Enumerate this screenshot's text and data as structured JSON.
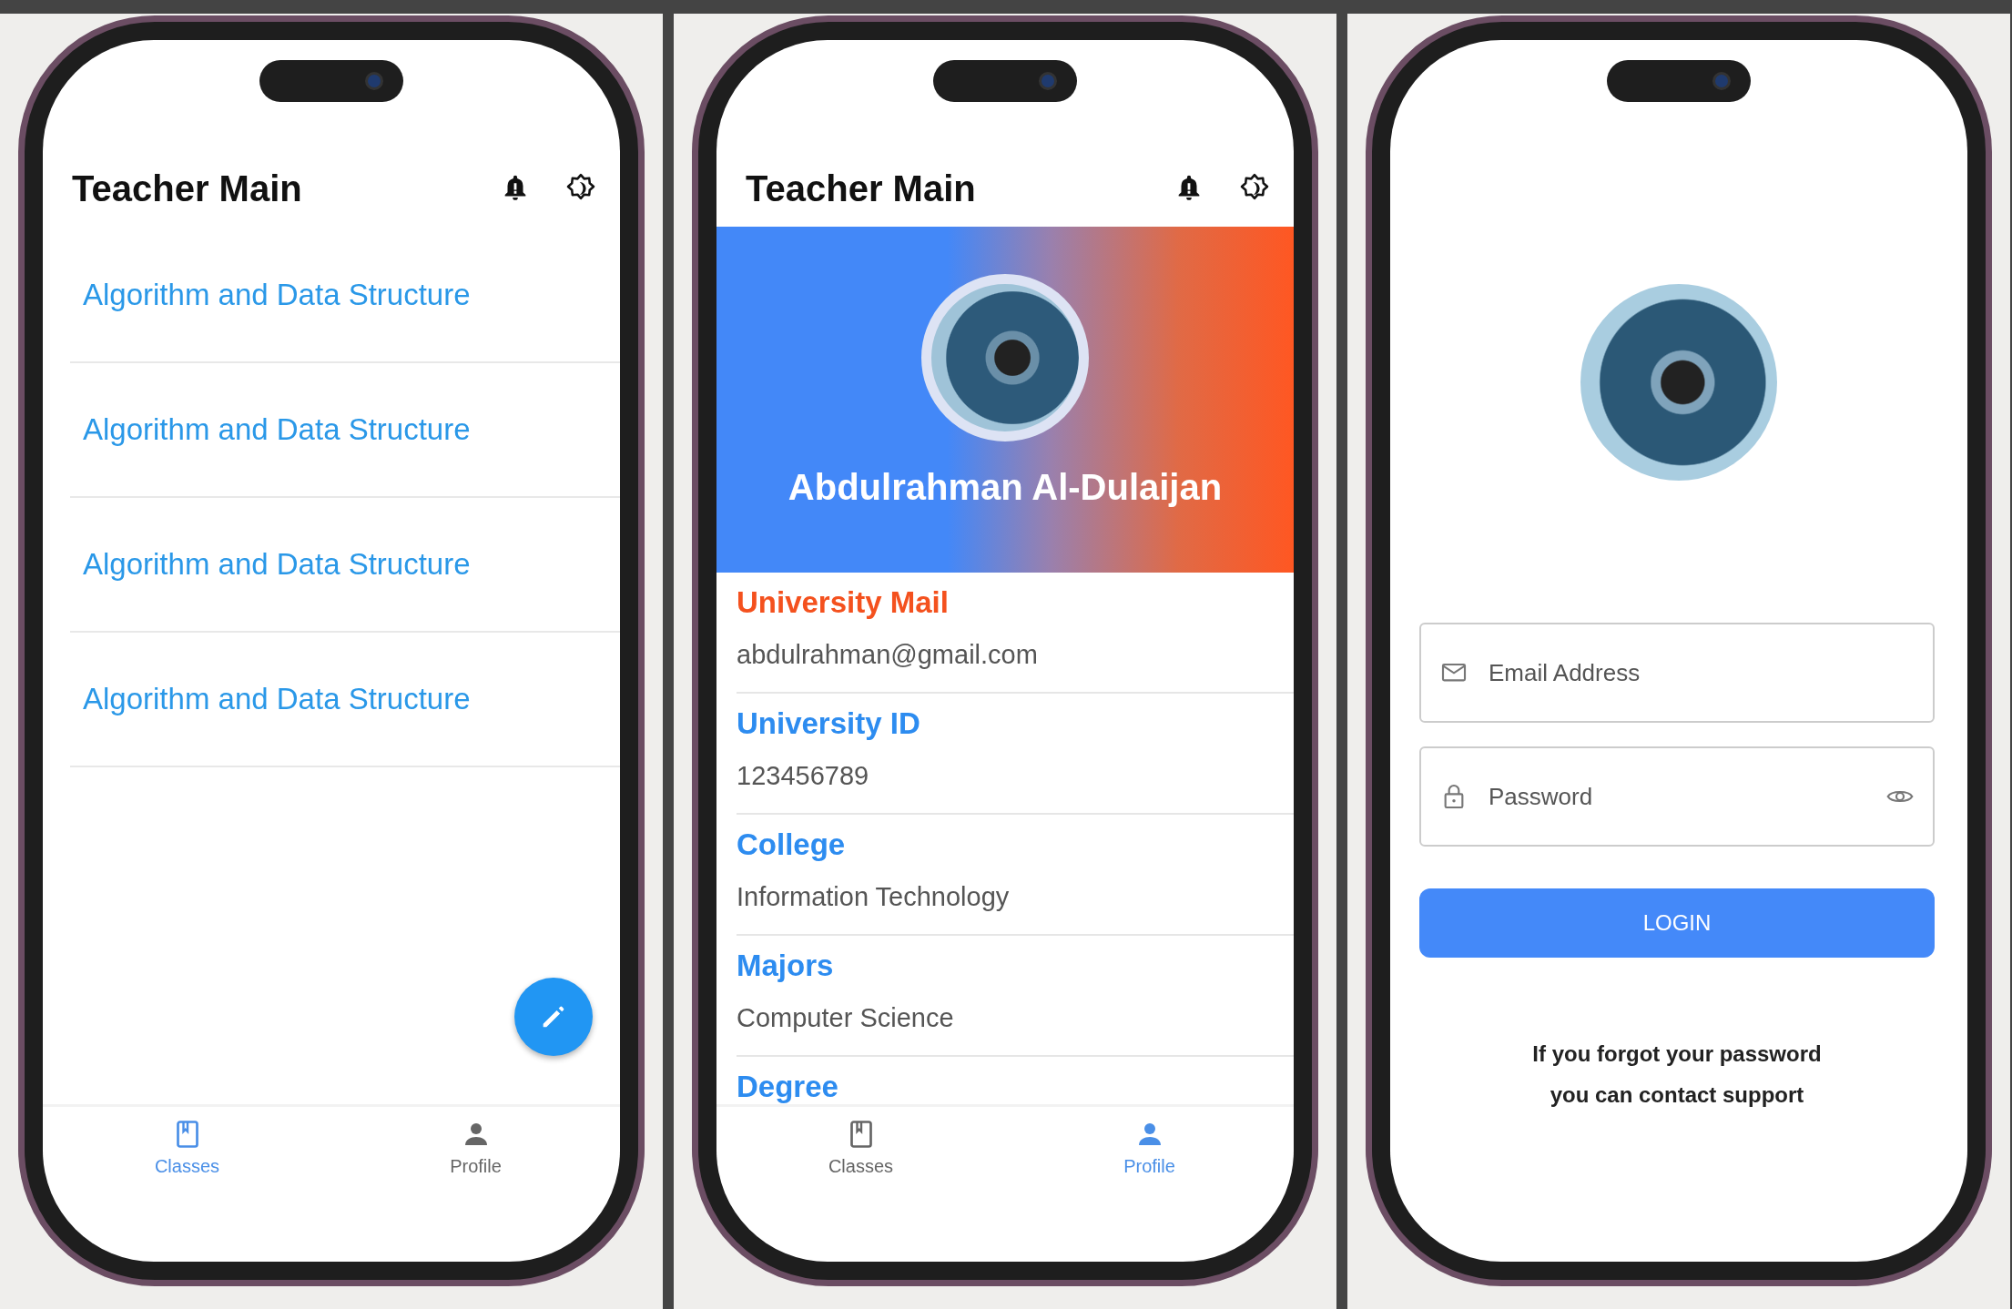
{
  "screens": [
    {
      "kind": "classes",
      "title": "Teacher Main",
      "classes": [
        "Algorithm and Data Structure",
        "Algorithm and Data Structure",
        "Algorithm and Data Structure",
        "Algorithm and Data Structure"
      ],
      "nav": [
        {
          "label": "Classes",
          "selected": true
        },
        {
          "label": "Profile",
          "selected": false
        }
      ]
    },
    {
      "kind": "profile",
      "title": "Teacher Main",
      "name": "Abdulrahman Al-Dulaijan",
      "fields": [
        {
          "label": "University Mail",
          "value": "abdulrahman@gmail.com",
          "color": "#f4511e"
        },
        {
          "label": "University ID",
          "value": "123456789",
          "color": "#2d8cf0"
        },
        {
          "label": "College",
          "value": "Information Technology",
          "color": "#2d8cf0"
        },
        {
          "label": "Majors",
          "value": "Computer Science",
          "color": "#2d8cf0"
        },
        {
          "label": "Degree",
          "color": "#2d8cf0"
        }
      ],
      "nav": [
        {
          "label": "Classes",
          "selected": false
        },
        {
          "label": "Profile",
          "selected": true
        }
      ]
    },
    {
      "kind": "login",
      "email": {
        "placeholder": "Email Address"
      },
      "password": {
        "placeholder": "Password"
      },
      "button": "LOGIN",
      "help": [
        "If you forgot your password",
        "you can contact support"
      ]
    }
  ]
}
